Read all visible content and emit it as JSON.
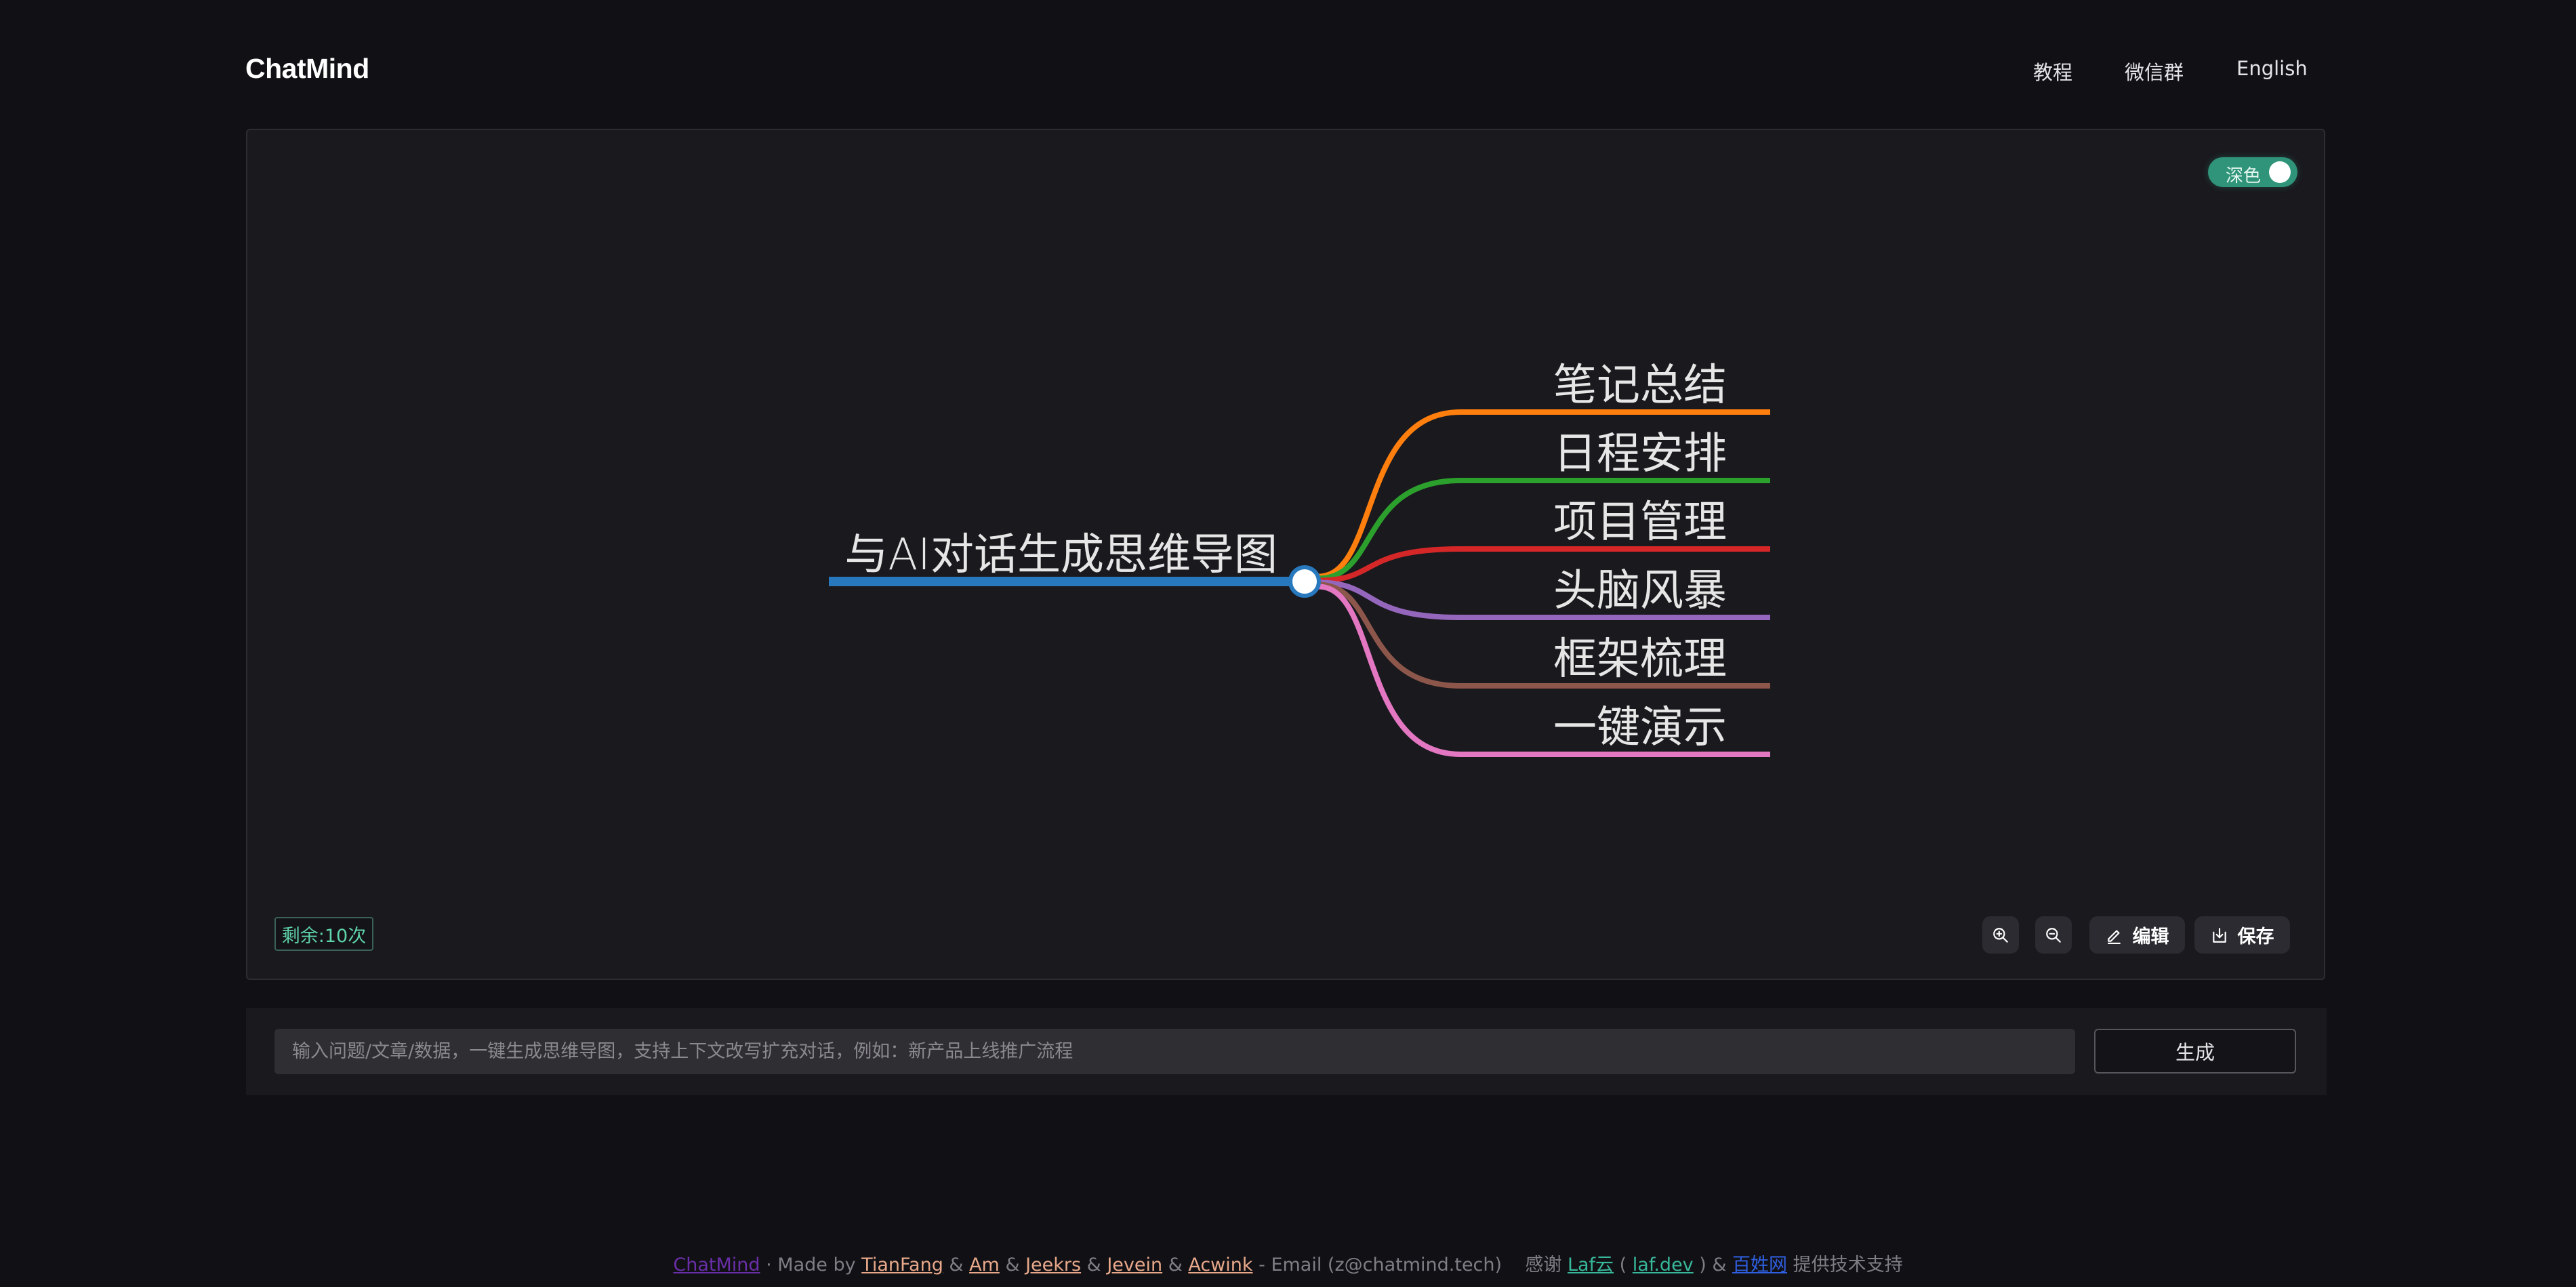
{
  "header": {
    "logo": "ChatMind",
    "nav": [
      {
        "label": "教程"
      },
      {
        "label": "微信群"
      },
      {
        "label": "English"
      }
    ]
  },
  "canvas": {
    "theme_toggle": {
      "label": "深色",
      "on": true,
      "color": "#2f9479"
    },
    "remaining_badge": "剩余:10次",
    "toolbar": {
      "zoom_in_icon": "zoom-in-icon",
      "zoom_out_icon": "zoom-out-icon",
      "edit_label": "编辑",
      "edit_icon": "pencil-icon",
      "save_label": "保存",
      "save_icon": "download-icon"
    },
    "mindmap": {
      "root": {
        "label": "与AI对话生成思维导图",
        "color": "#2878bd"
      },
      "children": [
        {
          "label": "笔记总结",
          "color": "#ff7f0e"
        },
        {
          "label": "日程安排",
          "color": "#2ca02c"
        },
        {
          "label": "项目管理",
          "color": "#d62728"
        },
        {
          "label": "头脑风暴",
          "color": "#9467bd"
        },
        {
          "label": "框架梳理",
          "color": "#8c564b"
        },
        {
          "label": "一键演示",
          "color": "#e377c2"
        }
      ]
    }
  },
  "prompt": {
    "placeholder": "输入问题/文章/数据，一键生成思维导图，支持上下文改写扩充对话，例如：新产品上线推广流程",
    "value": "",
    "generate_label": "生成"
  },
  "footer": {
    "brand": "ChatMind",
    "made_by": " · Made by ",
    "authors": [
      "TianFang",
      "Am",
      "Jeekrs",
      "Jevein",
      "Acwink"
    ],
    "sep": " & ",
    "email": " - Email (z@chatmind.tech)    感谢 ",
    "laf_cloud": "Laf云",
    "paren_open": " ( ",
    "laf_dev": "laf.dev",
    "paren_close": " ) & ",
    "baixing": "百姓网",
    "support": " 提供技术支持",
    "colors": {
      "brand": "#6a2fa8",
      "author": "#e8a98a",
      "laf": "#38b79a",
      "baixing": "#2f5fe0"
    }
  }
}
